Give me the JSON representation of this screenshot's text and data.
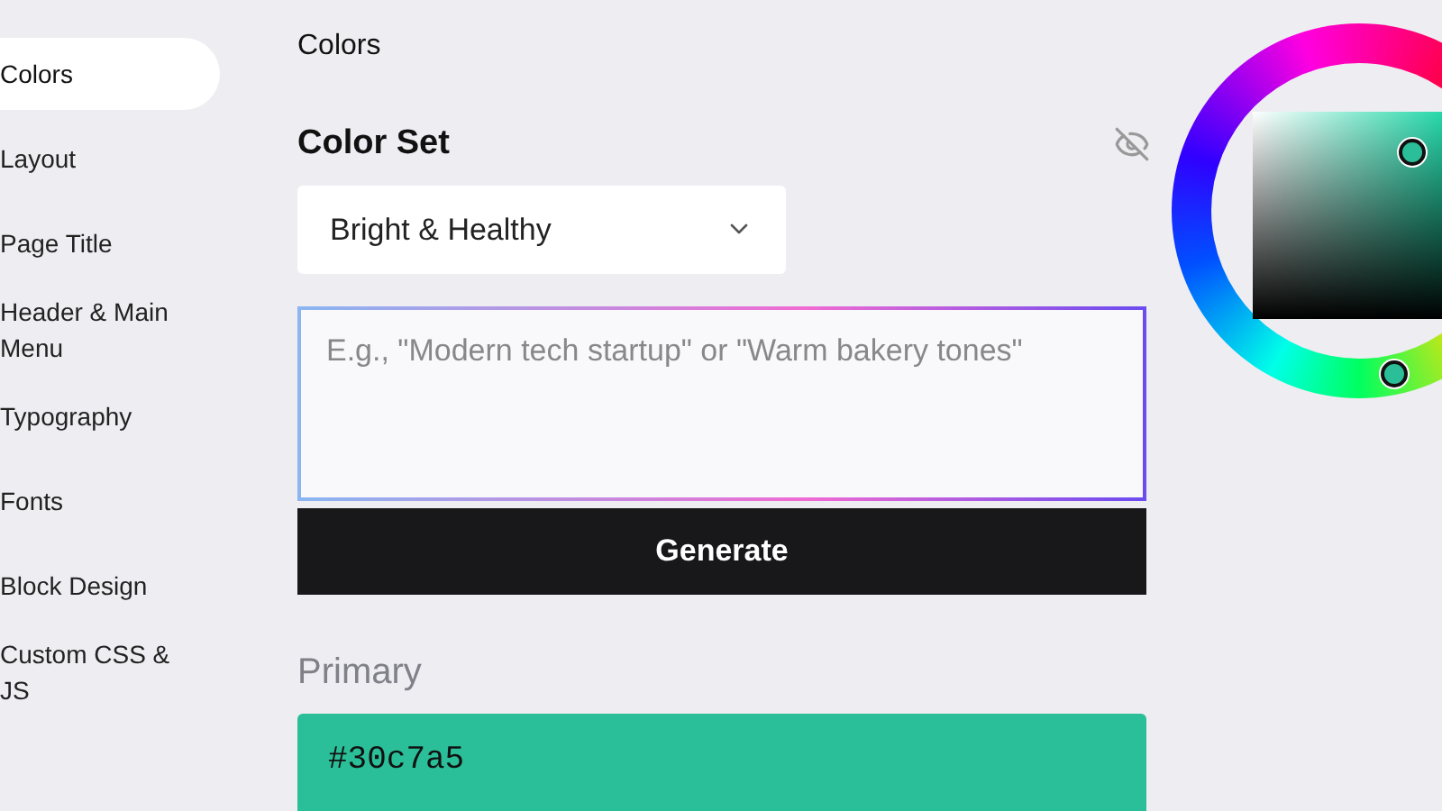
{
  "sidebar": {
    "items": [
      {
        "label": "Colors",
        "selected": true
      },
      {
        "label": "Layout",
        "selected": false
      },
      {
        "label": "Page Title",
        "selected": false
      },
      {
        "label": "Header & Main Menu",
        "selected": false
      },
      {
        "label": "Typography",
        "selected": false
      },
      {
        "label": "Fonts",
        "selected": false
      },
      {
        "label": "Block Design",
        "selected": false
      },
      {
        "label": "Custom CSS & JS",
        "selected": false
      }
    ]
  },
  "section_title": "Colors",
  "color_set": {
    "heading": "Color Set",
    "value": "Bright & Healthy"
  },
  "prompt": {
    "placeholder": "E.g., \"Modern tech startup\" or \"Warm bakery tones\""
  },
  "generate_button": "Generate",
  "primary": {
    "label": "Primary",
    "value": "#30c7a5",
    "color": "#2bbf99"
  }
}
